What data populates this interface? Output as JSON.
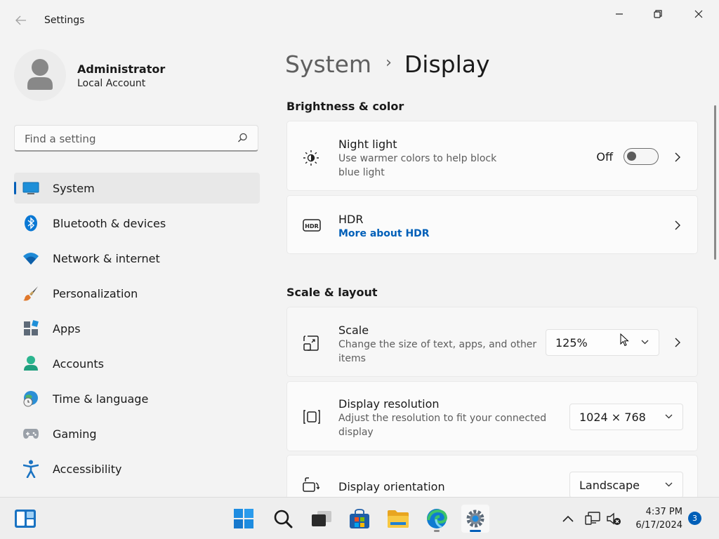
{
  "window": {
    "title": "Settings"
  },
  "profile": {
    "name": "Administrator",
    "account_type": "Local Account"
  },
  "search": {
    "placeholder": "Find a setting"
  },
  "sidebar": {
    "items": [
      {
        "label": "System",
        "icon": "monitor-icon",
        "selected": true
      },
      {
        "label": "Bluetooth & devices",
        "icon": "bluetooth-icon"
      },
      {
        "label": "Network & internet",
        "icon": "wifi-icon"
      },
      {
        "label": "Personalization",
        "icon": "paintbrush-icon"
      },
      {
        "label": "Apps",
        "icon": "apps-icon"
      },
      {
        "label": "Accounts",
        "icon": "person-icon"
      },
      {
        "label": "Time & language",
        "icon": "globe-clock-icon"
      },
      {
        "label": "Gaming",
        "icon": "gamepad-icon"
      },
      {
        "label": "Accessibility",
        "icon": "accessibility-icon"
      }
    ]
  },
  "breadcrumb": {
    "parent": "System",
    "separator": "›",
    "current": "Display"
  },
  "sections": {
    "brightness": {
      "title": "Brightness & color",
      "night_light": {
        "title": "Night light",
        "description": "Use warmer colors to help block blue light",
        "state": "Off"
      },
      "hdr": {
        "title": "HDR",
        "link": "More about HDR"
      }
    },
    "scale_layout": {
      "title": "Scale & layout",
      "scale": {
        "title": "Scale",
        "description": "Change the size of text, apps, and other items",
        "value": "125%"
      },
      "resolution": {
        "title": "Display resolution",
        "description": "Adjust the resolution to fit your connected display",
        "value": "1024 × 768"
      },
      "orientation": {
        "title": "Display orientation",
        "value": "Landscape"
      }
    }
  },
  "taskbar": {
    "time": "4:37 PM",
    "date": "6/17/2024",
    "notification_count": "3"
  },
  "colors": {
    "accent": "#005fb8",
    "background": "#f3f3f3",
    "card": "#fbfbfb"
  }
}
